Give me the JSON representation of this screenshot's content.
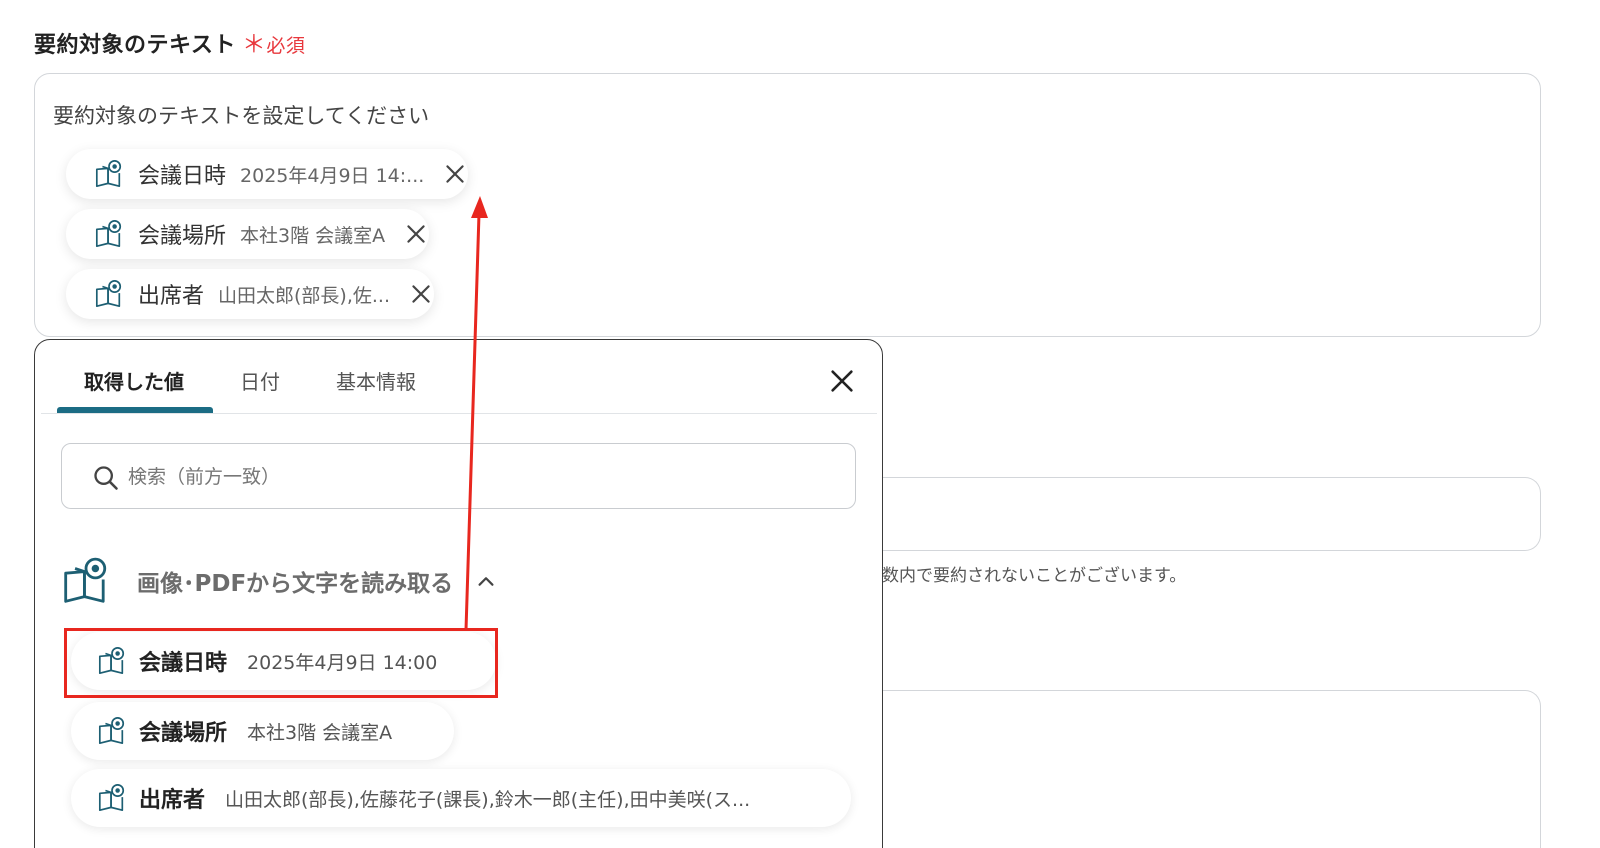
{
  "field": {
    "label": "要約対象のテキスト",
    "required_mark": "＊",
    "required_text": "必須",
    "placeholder": "要約対象のテキストを設定してください"
  },
  "selected_chips": [
    {
      "name": "会議日時",
      "value": "2025年4月9日 14:...",
      "icon": "book-eye-icon",
      "remove_icon": "close-icon"
    },
    {
      "name": "会議場所",
      "value": "本社3階 会議室A",
      "icon": "book-eye-icon",
      "remove_icon": "close-icon"
    },
    {
      "name": "出席者",
      "value": "山田太郎(部長),佐...",
      "icon": "book-eye-icon",
      "remove_icon": "close-icon"
    }
  ],
  "background": {
    "helper_text": "数内で要約されないことがございます。"
  },
  "popup": {
    "tabs": [
      {
        "label": "取得した値",
        "active": true
      },
      {
        "label": "日付",
        "active": false
      },
      {
        "label": "基本情報",
        "active": false
      }
    ],
    "search_placeholder": "検索（前方一致）",
    "section_title": "画像･PDFから文字を読み取る",
    "items": [
      {
        "name": "会議日時",
        "value": "2025年4月9日 14:00",
        "highlighted": true
      },
      {
        "name": "会議場所",
        "value": "本社3階 会議室A",
        "highlighted": false
      },
      {
        "name": "出席者",
        "value": "山田太郎(部長),佐藤花子(課長),鈴木一郎(主任),田中美咲(ス...",
        "highlighted": false
      }
    ]
  },
  "colors": {
    "accent": "#1b6c84",
    "required": "#e8383d",
    "annotation_red": "#e8271f",
    "icon_teal": "#1d5f73"
  }
}
